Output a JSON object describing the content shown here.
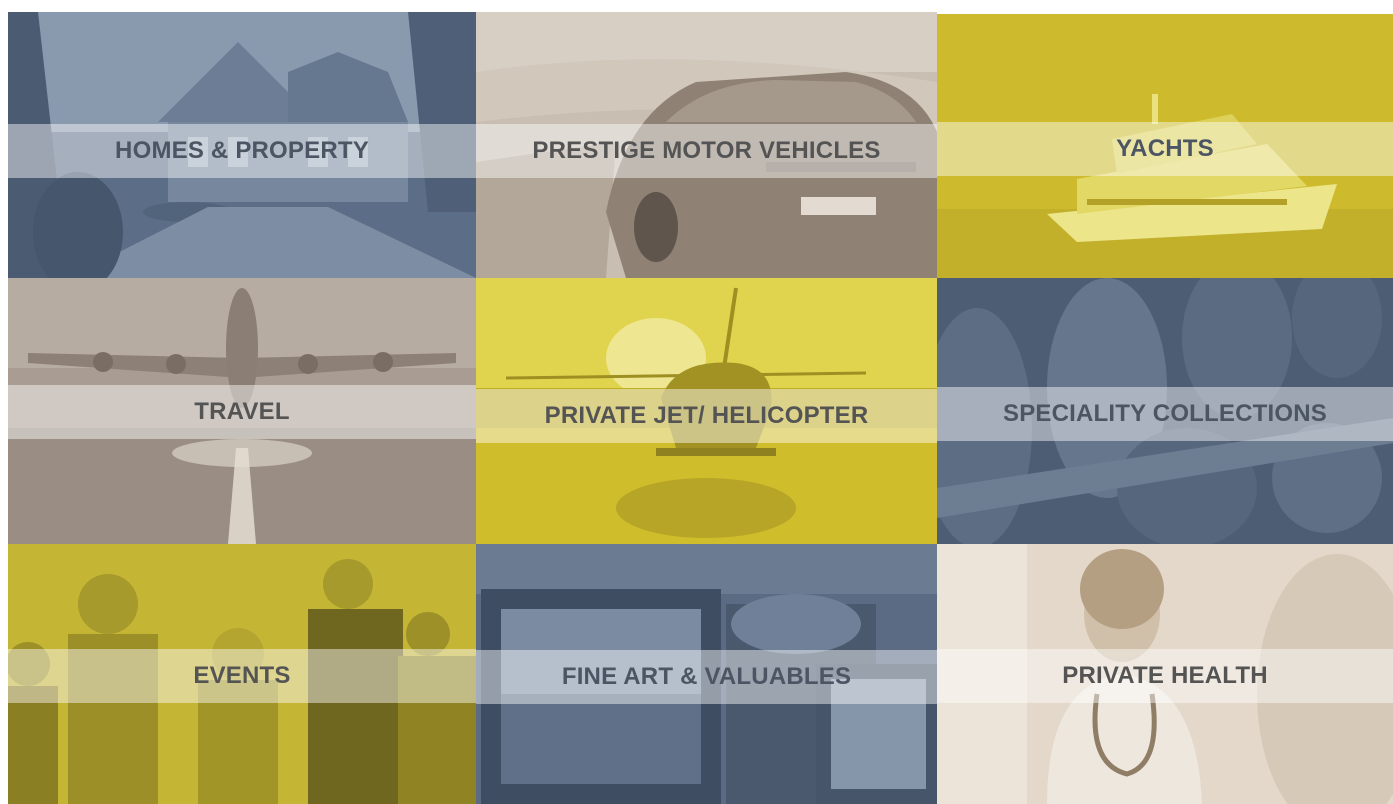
{
  "tiles": [
    {
      "label": "HOMES & PROPERTY",
      "photo": "house",
      "tint": "#5c6e87"
    },
    {
      "label": "PRESTIGE MOTOR VEHICLES",
      "photo": "sports-car",
      "tint": "#bfb3a6"
    },
    {
      "label": "YACHTS",
      "photo": "yacht",
      "tint": "#cdbb2d"
    },
    {
      "label": "TRAVEL",
      "photo": "airplane",
      "tint": "#a99d93"
    },
    {
      "label": "PRIVATE JET/ HELICOPTER",
      "photo": "helicopter",
      "tint": "#cfbd2b"
    },
    {
      "label": "SPECIALITY COLLECTIONS",
      "photo": "wine-bottles",
      "tint": "#4d5d74"
    },
    {
      "label": "EVENTS",
      "photo": "party-crowd",
      "tint": "#c4b535"
    },
    {
      "label": "FINE ART & VALUABLES",
      "photo": "picture-frames",
      "tint": "#5a6b83"
    },
    {
      "label": "PRIVATE HEALTH",
      "photo": "doctor",
      "tint": "#e3d8c9"
    }
  ]
}
